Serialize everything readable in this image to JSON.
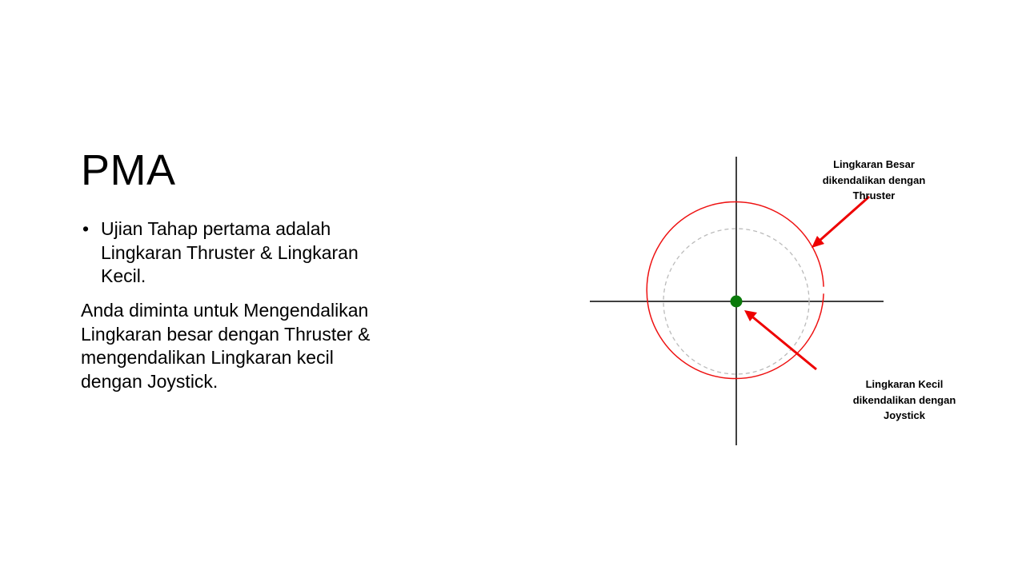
{
  "slide": {
    "title": "PMA",
    "bullets": [
      "Ujian Tahap pertama adalah Lingkaran Thruster & Lingkaran Kecil."
    ],
    "paragraph": "Anda diminta untuk Mengendalikan Lingkaran besar dengan Thruster & mengendalikan Lingkaran kecil dengan Joystick."
  },
  "diagram": {
    "annotations": {
      "big_circle": [
        "Lingkaran Besar",
        "dikendalikan dengan",
        "Thruster"
      ],
      "small_circle": [
        "Lingkaran Kecil",
        "dikendalikan dengan",
        "Joystick"
      ]
    },
    "colors": {
      "big_circle": "#ee1111",
      "small_circle_dashed": "#bbbbbb",
      "center_dot": "#0b7a0b",
      "arrows": "#ee0000",
      "axes": "#000000"
    }
  }
}
